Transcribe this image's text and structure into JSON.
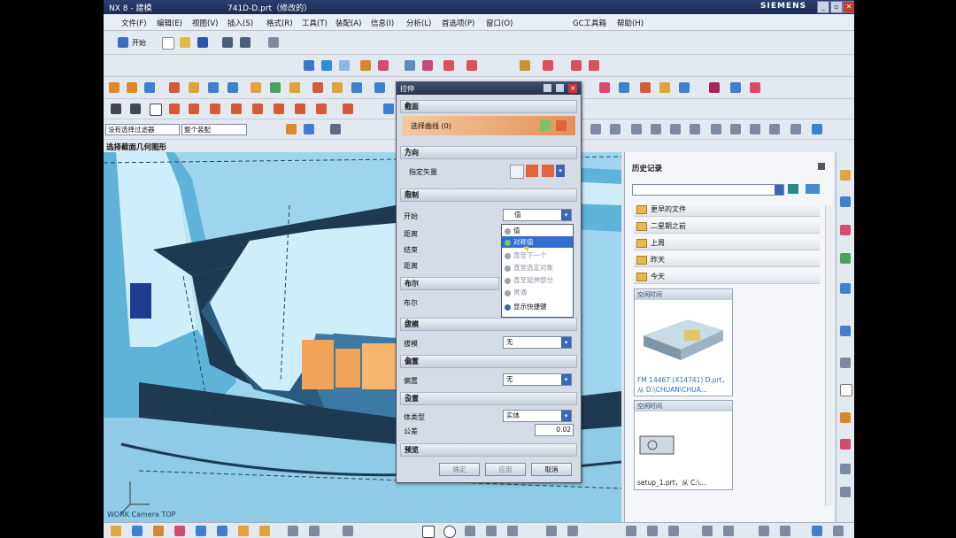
{
  "window": {
    "app_title": "NX 8 - 建模",
    "document_title": "741D-D.prt（修改的）",
    "brand": "SIEMENS"
  },
  "menu": [
    "文件(F)",
    "编辑(E)",
    "视图(V)",
    "插入(S)",
    "格式(R)",
    "工具(T)",
    "装配(A)",
    "信息(I)",
    "分析(L)",
    "首选项(P)",
    "窗口(O)",
    "GC工具箱",
    "帮助(H)"
  ],
  "toolbar": {
    "start_label": "开始",
    "filter_select": "没有选择过滤器",
    "scope_select": "整个装配"
  },
  "hint_text": "选择截面几何图形",
  "viewport_label": "WORK Camera TOP",
  "dialog": {
    "title": "拉伸",
    "sections": {
      "section": "截面",
      "direction": "方向",
      "limits": "限制",
      "boolean": "布尔",
      "draft": "拔模",
      "offset": "偏置",
      "settings": "设置",
      "preview": "预览"
    },
    "select_curve": "选择曲线 (0)",
    "specify_vector": "指定矢量",
    "start_label": "开始",
    "start_value": "值",
    "distance_label": "距离",
    "end_label": "结束",
    "distance2_label": "距离",
    "boolean_label": "布尔",
    "draft_label": "拔模",
    "draft_value": "无",
    "offset_label": "偏置",
    "offset_value": "无",
    "body_type_label": "体类型",
    "body_type_value": "实体",
    "tolerance_label": "公差",
    "tolerance_value": "0.02",
    "dropdown_options": [
      "值",
      "对称值",
      "直至下一个",
      "直至选定对象",
      "直至延伸部分",
      "贯通",
      "显示快捷键"
    ],
    "selected_option_index": 1,
    "buttons": {
      "ok": "确定",
      "apply": "应用",
      "cancel": "取消"
    }
  },
  "history": {
    "title": "历史记录",
    "groups": [
      "更早的文件",
      "二星期之前",
      "上周",
      "昨天",
      "今天"
    ],
    "card1_header": "空闲时间",
    "card1_caption": "FM 14467 (X14741) D.prt，从 D:\\CHUAN\\CHUA...",
    "card2_header": "空闲时间",
    "card2_caption": "setup_1.prt，从 C:\\..."
  },
  "colors": {
    "viewport_bg": "#9fd4ee",
    "part_dark": "#1d3a52",
    "part_light": "#cfeefc",
    "highlight_orange": "#f2a35a",
    "selection_blue": "#2e6fd1"
  }
}
